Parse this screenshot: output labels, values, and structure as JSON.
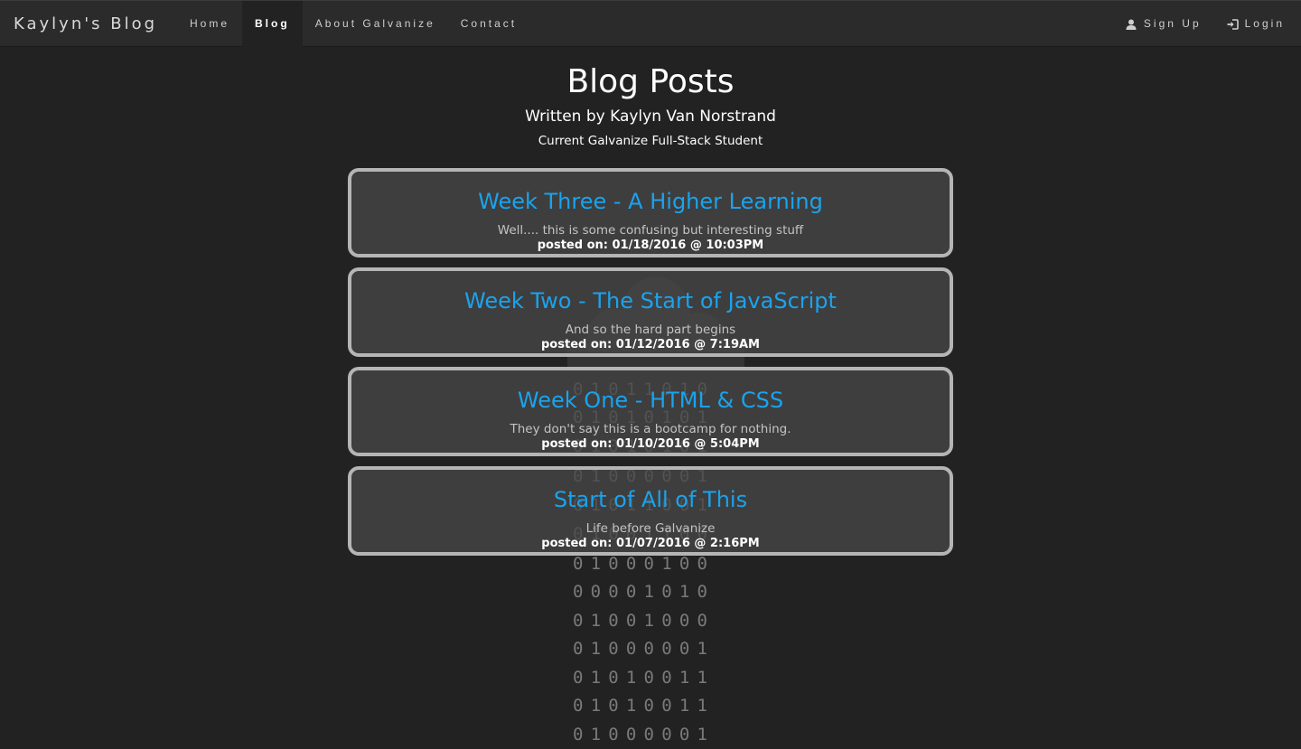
{
  "navbar": {
    "brand": "Kaylyn's Blog",
    "links": [
      {
        "label": "Home",
        "active": false
      },
      {
        "label": "Blog",
        "active": true
      },
      {
        "label": "About Galvanize",
        "active": false
      },
      {
        "label": "Contact",
        "active": false
      }
    ],
    "right": {
      "signup_label": "Sign Up",
      "signup_icon": "user-icon",
      "login_label": "Login",
      "login_icon": "login-icon"
    }
  },
  "header": {
    "title": "Blog Posts",
    "subtitle": "Written by Kaylyn Van Norstrand",
    "tagline": "Current Galvanize Full-Stack Student"
  },
  "posts": [
    {
      "title": "Week Three - A Higher Learning",
      "description": "Well.... this is some confusing but interesting stuff",
      "posted": "posted on: 01/18/2016 @ 10:03PM"
    },
    {
      "title": "Week Two - The Start of JavaScript",
      "description": "And so the hard part begins",
      "posted": "posted on: 01/12/2016 @ 7:19AM"
    },
    {
      "title": "Week One - HTML & CSS",
      "description": "They don't say this is a bootcamp for nothing.",
      "posted": "posted on: 01/10/2016 @ 5:04PM"
    },
    {
      "title": "Start of All of This",
      "description": "Life before Galvanize",
      "posted": "posted on: 01/07/2016 @ 2:16PM"
    }
  ],
  "background_binary": [
    "01011010",
    "01010101",
    "01010101",
    "01000001",
    "01011001",
    "01001100",
    "01000100",
    "00001010",
    "01001000",
    "01000001",
    "01010011",
    "01010011",
    "01000001"
  ],
  "colors": {
    "background": "#222222",
    "navbar": "#2b2b2c",
    "post_title": "#1aa3ee",
    "post_border": "#b5b5b5"
  }
}
